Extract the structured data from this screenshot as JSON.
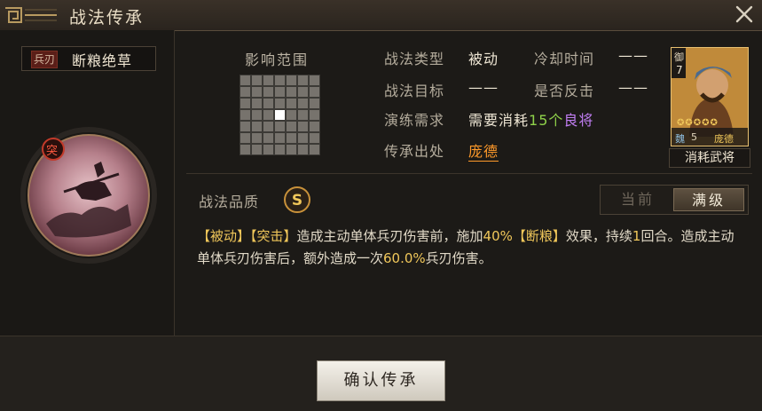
{
  "window": {
    "title": "战法传承"
  },
  "skill": {
    "troop_tag": "兵刃",
    "name": "断粮绝草",
    "icon_badge": "突"
  },
  "range": {
    "title": "影响范围",
    "grid_cols": 7,
    "grid_rows": 7,
    "highlight_cell": [
      3,
      3
    ]
  },
  "info": {
    "type_label": "战法类型",
    "type_value": "被动",
    "cooldown_label": "冷却时间",
    "cooldown_value": "——",
    "target_label": "战法目标",
    "target_value": "——",
    "counter_label": "是否反击",
    "counter_value": "——",
    "requirement_label": "演练需求",
    "requirement_prefix": "需要消耗",
    "requirement_count": "15个",
    "requirement_item": "良将",
    "source_label": "传承出处",
    "source_value": "庞德"
  },
  "general_card": {
    "cost": "7",
    "faction_mark": "御",
    "faction": "魏",
    "level": "5",
    "name": "庞德",
    "stars": 5,
    "label": "消耗武将"
  },
  "quality": {
    "label": "战法品质",
    "grade": "S"
  },
  "tabs": {
    "current": "当前",
    "max": "满级",
    "selected": "max"
  },
  "description": {
    "p1_tag1": "【被动】",
    "p1_tag2": "【突击】",
    "p1_text1": "造成主动单体兵刃伤害前，施加",
    "p1_pct": "40%",
    "p1_tag3": "【断粮】",
    "p1_text2": "效果，持续",
    "p1_turns": "1",
    "p1_text3": "回合。造成主动单体兵刃伤害后，额外造成一次",
    "p1_dmg": "60.0%",
    "p1_text4": "兵刃伤害。"
  },
  "confirm_button": "确认传承",
  "colors": {
    "accent_gold": "#f0c75a",
    "green": "#8fd24a",
    "purple": "#c07ef2",
    "orange": "#ff9a2a"
  }
}
